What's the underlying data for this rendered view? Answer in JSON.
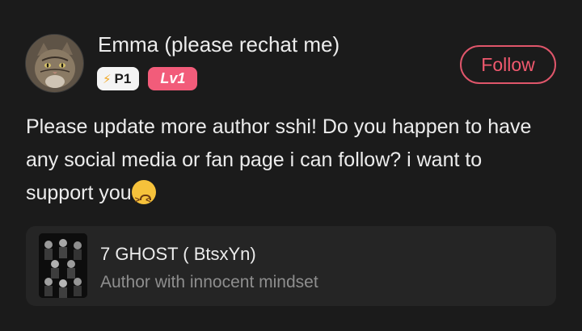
{
  "comment": {
    "author": {
      "name": "Emma (please rechat me)",
      "avatar_icon": "cat-photo-avatar",
      "badges": {
        "power_label": "P1",
        "power_icon": "lightning-bolt-icon",
        "level_label": "Lv1"
      }
    },
    "follow_button_label": "Follow",
    "text": "Please update more author sshi! Do you happen to have any social media or fan page i can follow? i want to support you",
    "trailing_emoji": "persevering-face-emoji"
  },
  "linked_book": {
    "title": "7 GHOST ( BtsxYn)",
    "subtitle": "Author with innocent mindset",
    "cover_icon": "book-cover-group-photo"
  },
  "colors": {
    "background": "#1b1b1b",
    "accent_red": "#f0596e",
    "level_badge": "#f25c7a",
    "card_background": "#252525",
    "muted_text": "#8e8e8e"
  }
}
